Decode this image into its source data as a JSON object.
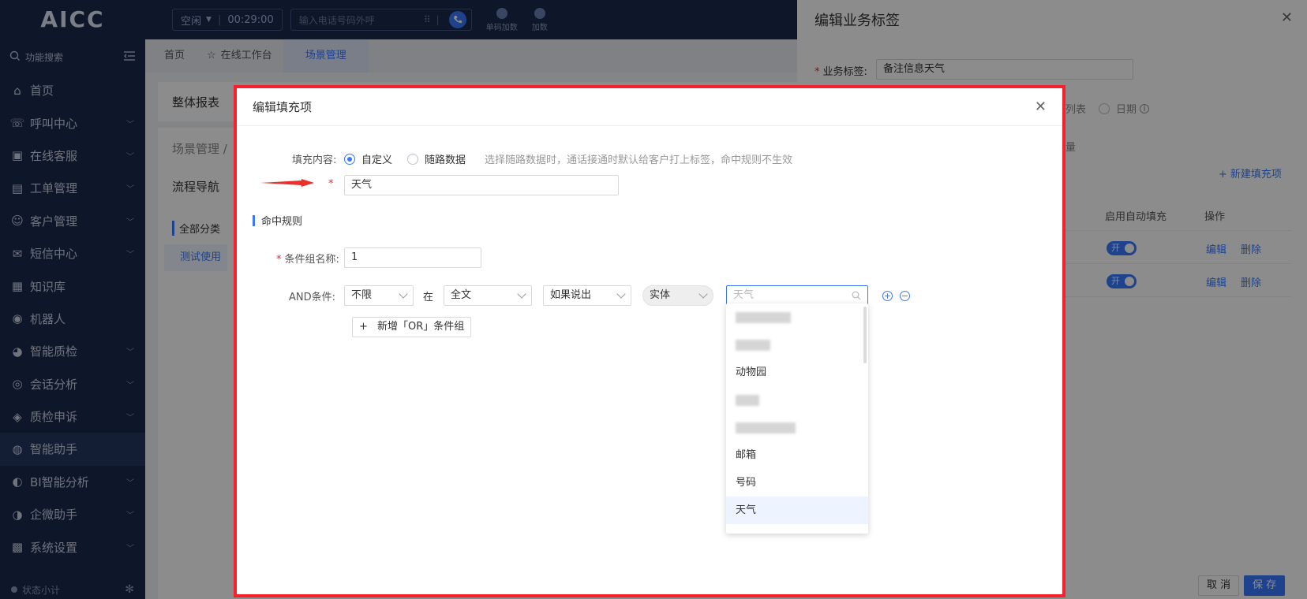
{
  "sidebar": {
    "logo": "AICC",
    "search_label": "功能搜索",
    "items": [
      {
        "label": "首页",
        "has_children": false,
        "active": false
      },
      {
        "label": "呼叫中心",
        "has_children": true,
        "active": false
      },
      {
        "label": "在线客服",
        "has_children": true,
        "active": false
      },
      {
        "label": "工单管理",
        "has_children": true,
        "active": false
      },
      {
        "label": "客户管理",
        "has_children": true,
        "active": false
      },
      {
        "label": "短信中心",
        "has_children": true,
        "active": false
      },
      {
        "label": "知识库",
        "has_children": false,
        "active": false
      },
      {
        "label": "机器人",
        "has_children": false,
        "active": false
      },
      {
        "label": "智能质检",
        "has_children": true,
        "active": false
      },
      {
        "label": "会话分析",
        "has_children": true,
        "active": false
      },
      {
        "label": "质检申诉",
        "has_children": true,
        "active": false
      },
      {
        "label": "智能助手",
        "has_children": false,
        "active": true
      },
      {
        "label": "BI智能分析",
        "has_children": true,
        "active": false
      },
      {
        "label": "企微助手",
        "has_children": true,
        "active": false
      },
      {
        "label": "系统设置",
        "has_children": true,
        "active": false
      }
    ],
    "bottom_label": "状态小计"
  },
  "topbar": {
    "status": "空闲",
    "timer": "00:29:00",
    "phone_placeholder": "输入电话号码外呼",
    "tools": [
      "单码加数",
      "加数"
    ]
  },
  "tabs": [
    {
      "label": "首页"
    },
    {
      "label": "在线工作台"
    },
    {
      "label": "场景管理"
    }
  ],
  "background": {
    "report_title": "整体报表",
    "breadcrumb": "场景管理 /",
    "flow_nav": "流程导航",
    "all_category": "全部分类",
    "test_use": "测试使用"
  },
  "drawer": {
    "title": "编辑业务标签",
    "biz_label": "业务标签:",
    "biz_value": "备注信息天气",
    "type_list_tail": "列表",
    "type_date": "日期",
    "fill_tail": "量",
    "new_fill": "新建填充项",
    "col_auto_fill": "启用自动填充",
    "col_ops": "操作",
    "rows": [
      {
        "toggle": "开",
        "edit": "编辑",
        "delete": "删除"
      },
      {
        "toggle": "开",
        "edit": "编辑",
        "delete": "删除"
      }
    ],
    "cancel": "取 消",
    "save": "保 存"
  },
  "modal": {
    "title": "编辑填充项",
    "fill_content_label": "填充内容:",
    "option_custom": "自定义",
    "option_random": "随路数据",
    "hint": "选择随路数据时，通话接通时默认给客户打上标签，命中规则不生效",
    "fill_value": "天气",
    "section_rules": "命中规则",
    "group_name_label": "条件组名称:",
    "group_name_value": "1",
    "and_label": "AND条件:",
    "cond_scope": "不限",
    "cond_in": "在",
    "cond_area": "全文",
    "cond_if": "如果说出",
    "cond_entity": "实体",
    "entity_search_placeholder": "天气",
    "add_or_group": "新增「OR」条件组"
  },
  "dropdown": {
    "items": [
      "动物园",
      "邮箱",
      "号码",
      "天气"
    ],
    "selected": "天气"
  },
  "colors": {
    "sidebar_bg": "#1b2a4e",
    "primary": "#3a78ff",
    "highlight_border": "#f5222d"
  }
}
